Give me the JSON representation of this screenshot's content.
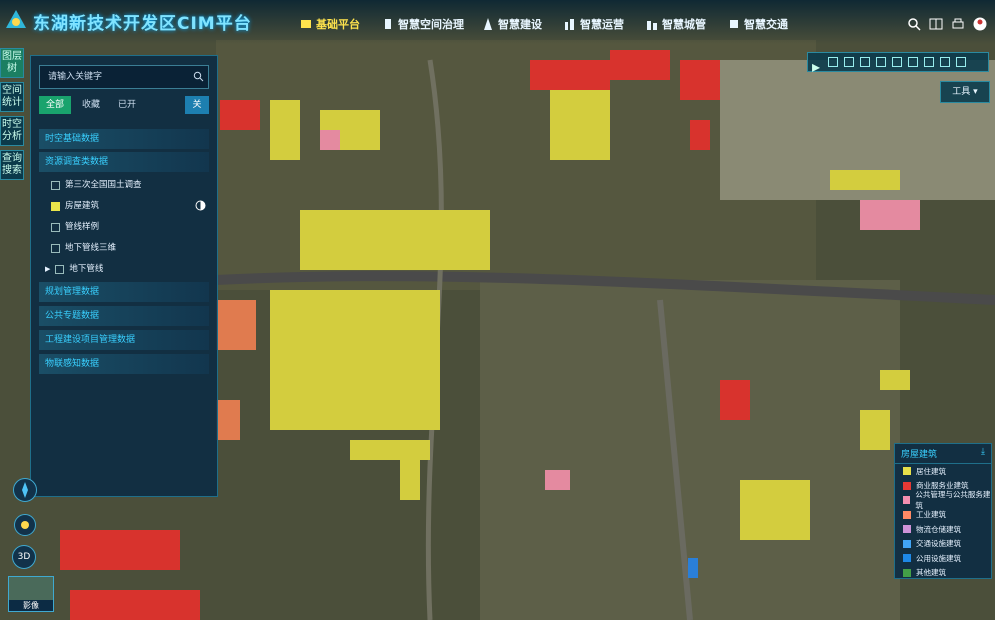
{
  "app": {
    "title": "东湖新技术开发区CIM平台"
  },
  "nav": [
    {
      "label": "基础平台",
      "active": true
    },
    {
      "label": "智慧空间治理"
    },
    {
      "label": "智慧建设"
    },
    {
      "label": "智慧运营"
    },
    {
      "label": "智慧城管"
    },
    {
      "label": "智慧交通"
    }
  ],
  "leftstrip": [
    {
      "label": "图层树",
      "active": true
    },
    {
      "label": "空间统计"
    },
    {
      "label": "时空分析"
    },
    {
      "label": "查询搜索"
    }
  ],
  "panel": {
    "search_placeholder": "请输入关键字",
    "filters": [
      "全部",
      "收藏",
      "已开"
    ],
    "toggle": "关",
    "categories": [
      "时空基础数据",
      "资源调查类数据",
      "规划管理数据",
      "公共专题数据",
      "工程建设项目管理数据",
      "物联感知数据"
    ],
    "items": [
      {
        "label": "第三次全国国土调查",
        "checked": false
      },
      {
        "label": "房屋建筑",
        "checked": true
      },
      {
        "label": "管线样例",
        "checked": false
      },
      {
        "label": "地下管线三维",
        "checked": false
      },
      {
        "label": "地下管线",
        "checked": false
      }
    ]
  },
  "toolbar": {
    "tools_label": "工具"
  },
  "legend": {
    "title": "房屋建筑",
    "items": [
      {
        "label": "居住建筑",
        "color": "#e6e04a"
      },
      {
        "label": "商业服务业建筑",
        "color": "#e53935"
      },
      {
        "label": "公共管理与公共服务建筑",
        "color": "#f48fb1"
      },
      {
        "label": "工业建筑",
        "color": "#ff8a65"
      },
      {
        "label": "物流仓储建筑",
        "color": "#ce93d8"
      },
      {
        "label": "交通设施建筑",
        "color": "#42a5f5"
      },
      {
        "label": "公用设施建筑",
        "color": "#1e88e5"
      },
      {
        "label": "其他建筑",
        "color": "#43a047"
      }
    ]
  },
  "controls": {
    "btn3d": "3D",
    "minimap_label": "影像"
  }
}
